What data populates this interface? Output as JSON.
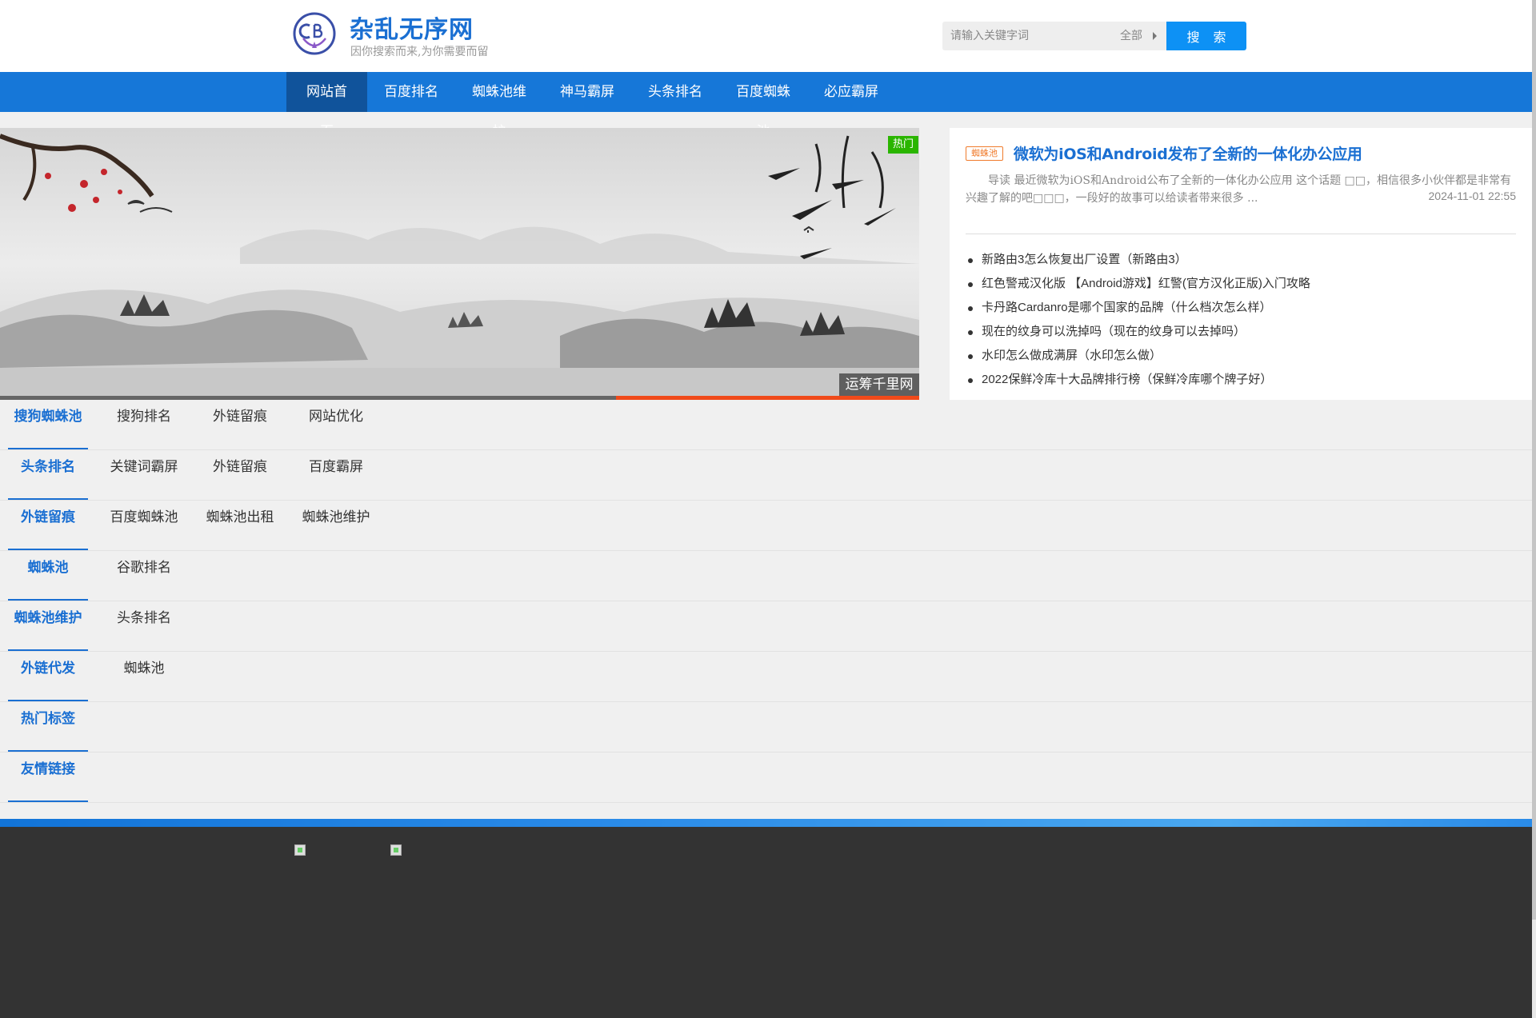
{
  "header": {
    "site_title": "杂乱无序网",
    "slogan": "因你搜索而来,为你需要而留",
    "search_placeholder": "请输入关键字词",
    "search_scope": "全部",
    "search_button": "搜 索"
  },
  "nav": {
    "items": [
      "网站首页",
      "百度排名",
      "蜘蛛池维护",
      "神马霸屏",
      "头条排名",
      "百度蜘蛛池",
      "必应霸屏"
    ]
  },
  "banner": {
    "hot_badge": "热门",
    "caption": "运筹千里网",
    "progress": 0.33
  },
  "featured": {
    "tag": "蜘蛛池",
    "title": "微软为iOS和Android发布了全新的一体化办公应用",
    "excerpt": "导读 最近微软为iOS和Android公布了全新的一体化办公应用 这个话题 □□，相信很多小伙伴都是非常有兴趣了解的吧□□□，一段好的故事可以给读者带来很多 ...",
    "date": "2024-11-01 22:55",
    "list": [
      "新路由3怎么恢复出厂设置（新路由3）",
      "红色警戒汉化版 【Android游戏】红警(官方汉化正版)入门攻略",
      "卡丹路Cardanro是哪个国家的品牌（什么档次怎么样）",
      "现在的纹身可以洗掉吗（现在的纹身可以去掉吗）",
      "水印怎么做成满屏（水印怎么做）",
      "2022保鲜冷库十大品牌排行榜（保鲜冷库哪个牌子好）"
    ]
  },
  "tag_rows": [
    {
      "label": "搜狗蜘蛛池",
      "links": [
        "搜狗排名",
        "外链留痕",
        "网站优化"
      ]
    },
    {
      "label": "头条排名",
      "links": [
        "关键词霸屏",
        "外链留痕",
        "百度霸屏"
      ]
    },
    {
      "label": "外链留痕",
      "links": [
        "百度蜘蛛池",
        "蜘蛛池出租",
        "蜘蛛池维护"
      ]
    },
    {
      "label": "蜘蛛池",
      "links": [
        "谷歌排名"
      ]
    },
    {
      "label": "蜘蛛池维护",
      "links": [
        "头条排名"
      ]
    },
    {
      "label": "外链代发",
      "links": [
        "蜘蛛池"
      ]
    },
    {
      "label": "热门标签",
      "links": []
    },
    {
      "label": "友情链接",
      "links": []
    }
  ]
}
